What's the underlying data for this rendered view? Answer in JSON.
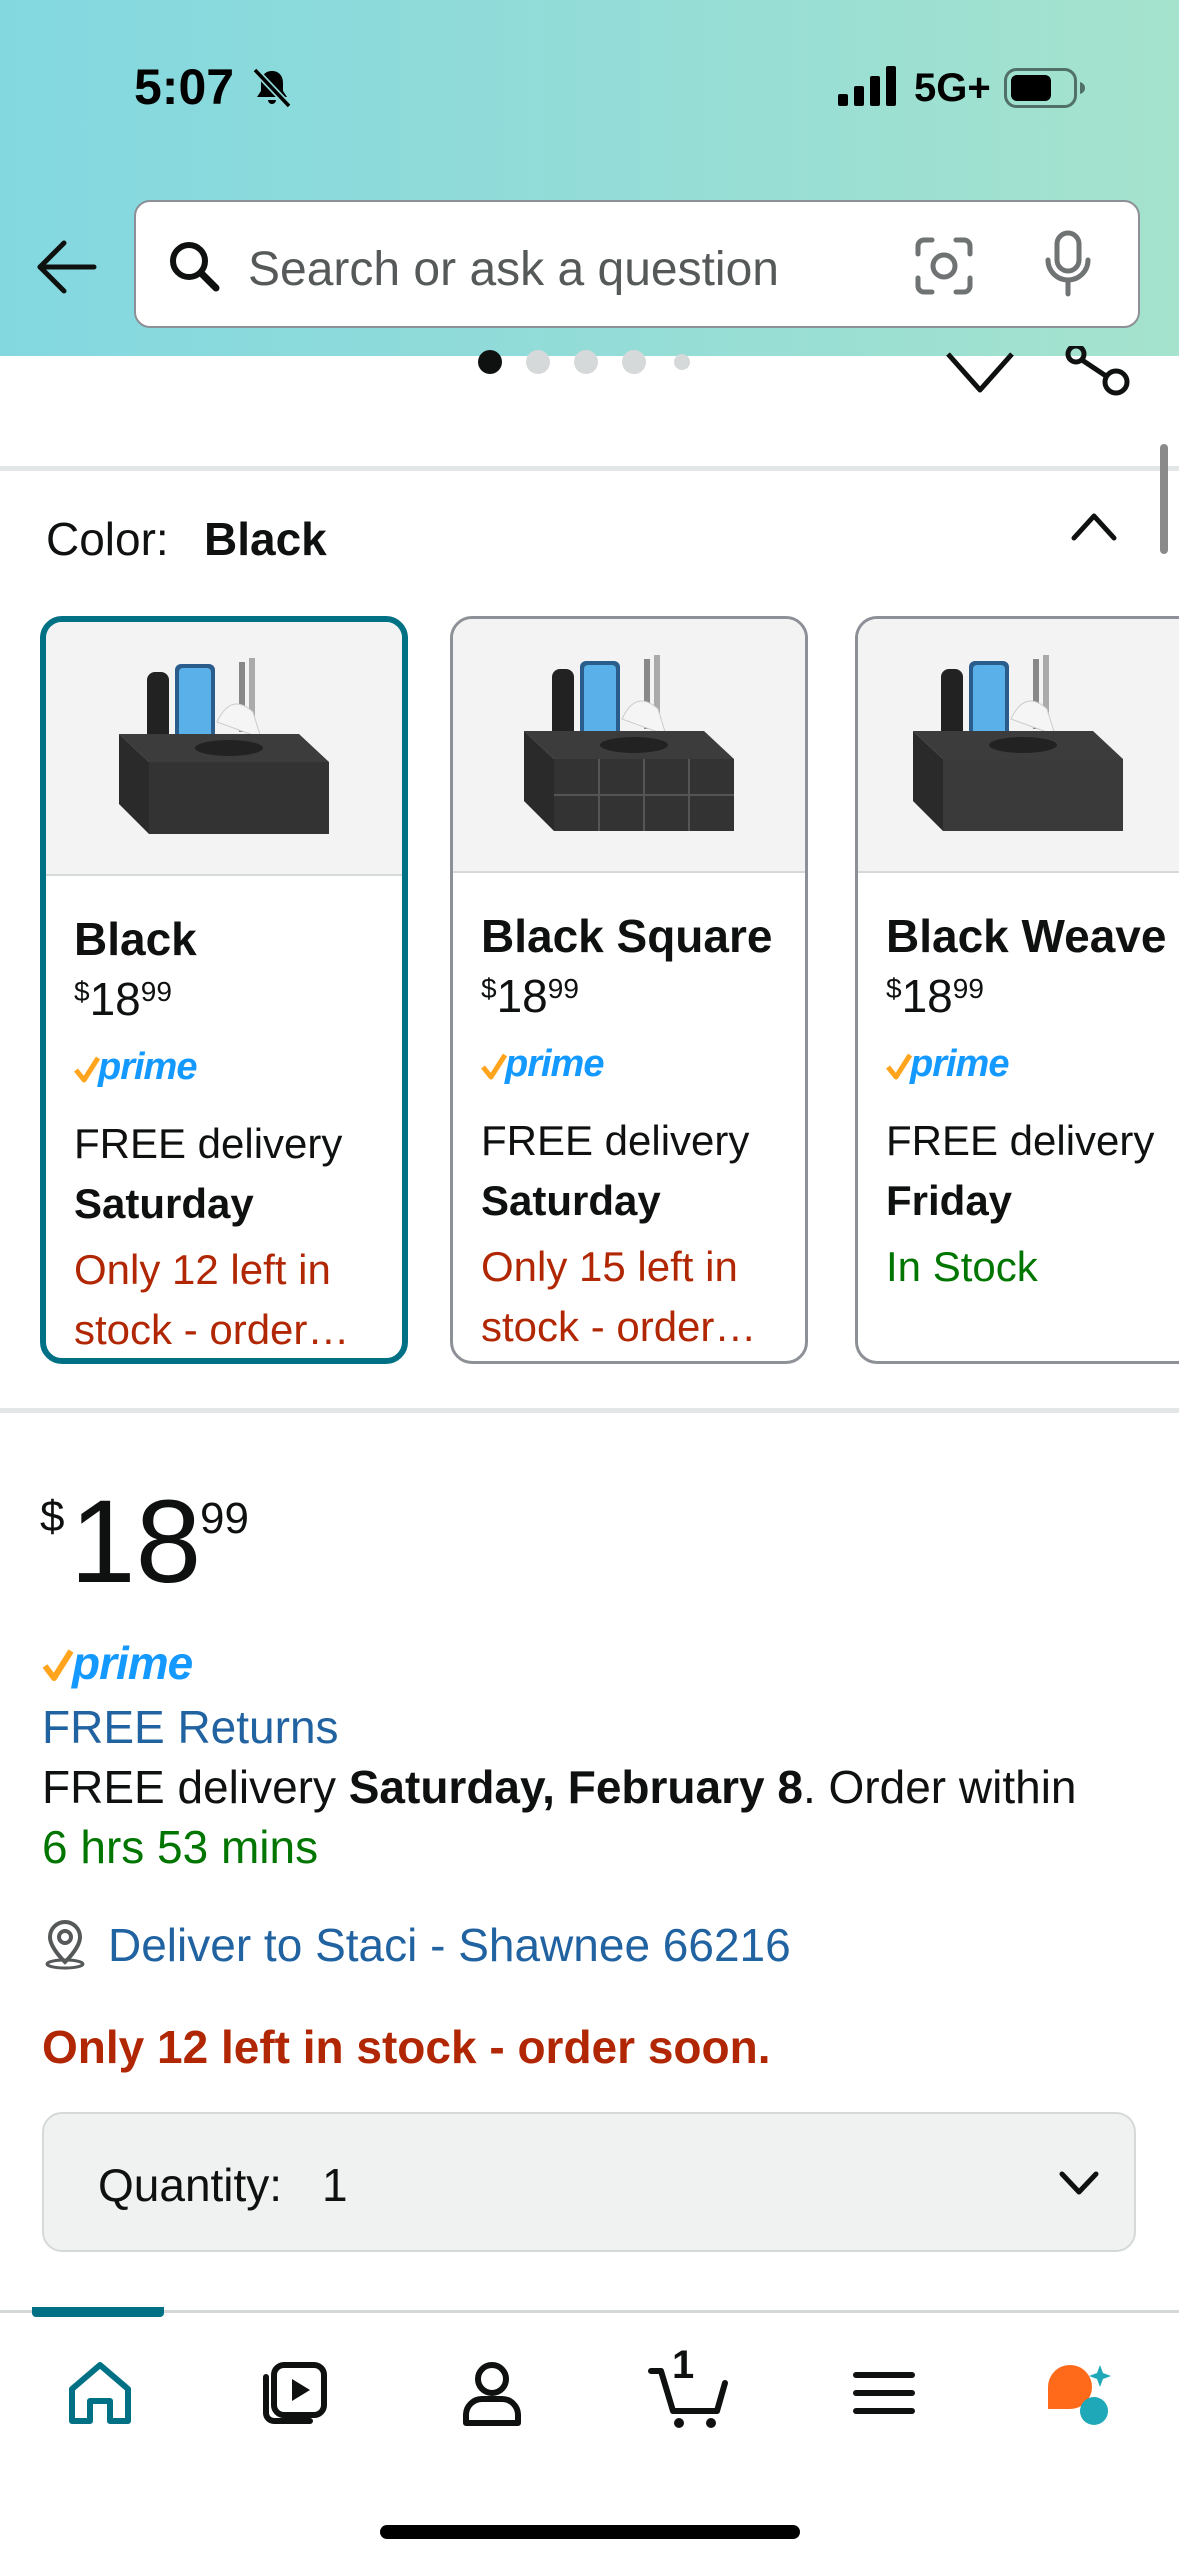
{
  "status_bar": {
    "time": "5:07",
    "network": "5G+",
    "icons": [
      "bell-off-icon",
      "signal-icon",
      "battery-icon"
    ]
  },
  "search": {
    "placeholder": "Search or ask a question",
    "icons": [
      "back-arrow-icon",
      "search-icon",
      "camera-lens-icon",
      "microphone-icon"
    ]
  },
  "carousel": {
    "dot_count": 5,
    "active_dot": 1,
    "icons": [
      "wishlist-heart-icon",
      "share-icon"
    ]
  },
  "color_selector": {
    "label": "Color:",
    "selected": "Black",
    "options": [
      {
        "name": "Black",
        "price_symbol": "$",
        "price_whole": "18",
        "price_cents": "99",
        "prime": "prime",
        "delivery": "FREE delivery",
        "day": "Saturday",
        "stock": "Only 12 left in stock - order…",
        "stock_status": "low",
        "selected": true
      },
      {
        "name": "Black Square",
        "price_symbol": "$",
        "price_whole": "18",
        "price_cents": "99",
        "prime": "prime",
        "delivery": "FREE delivery",
        "day": "Saturday",
        "stock": "Only 15 left in stock - order…",
        "stock_status": "low",
        "selected": false
      },
      {
        "name": "Black Weave",
        "price_symbol": "$",
        "price_whole": "18",
        "price_cents": "99",
        "prime": "prime",
        "delivery": "FREE delivery",
        "day": "Friday",
        "stock": "In Stock",
        "stock_status": "in",
        "selected": false
      }
    ]
  },
  "buybox": {
    "price_symbol": "$",
    "price_whole": "18",
    "price_cents": "99",
    "prime": "prime",
    "free_returns": "FREE Returns",
    "delivery_prefix": "FREE delivery ",
    "delivery_date": "Saturday, February 8",
    "delivery_suffix": ". Order within",
    "countdown": "6 hrs 53 mins",
    "deliver_to": "Deliver to Staci - Shawnee 66216",
    "stock_warning": "Only 12 left in stock - order soon.",
    "quantity_label": "Quantity:",
    "quantity_value": "1"
  },
  "bottom_nav": {
    "items": [
      "home-icon",
      "video-icon",
      "account-icon",
      "cart-icon",
      "menu-icon",
      "rufus-icon"
    ],
    "cart_count": "1",
    "active": "home"
  },
  "colors": {
    "accent_teal": "#007185",
    "link_blue": "#2162a1",
    "stock_red": "#b12704",
    "stock_green": "#007600",
    "prime_blue": "#1399ff",
    "prime_orange": "#ffa41c"
  }
}
